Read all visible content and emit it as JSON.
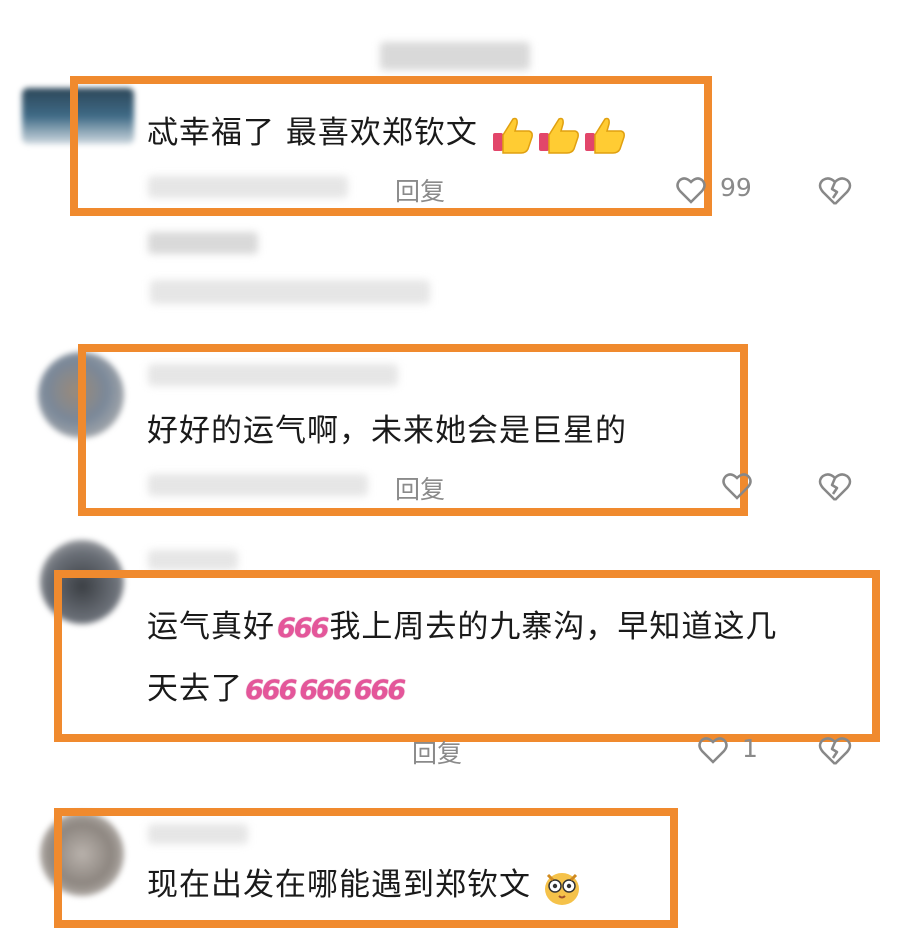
{
  "comments": [
    {
      "text": "忒幸福了 最喜欢郑钦文",
      "reply_label": "回复",
      "like_count": "99",
      "emoji": "thumbs-up x3"
    },
    {
      "text": "好好的运气啊，未来她会是巨星的",
      "reply_label": "回复"
    },
    {
      "text_line1": "运气真好",
      "text_line1b": "我上周去的九寨沟，早知道这几",
      "text_line2": "天去了",
      "six": "666",
      "reply_label": "回复",
      "like_count": "1"
    },
    {
      "text": "现在出发在哪能遇到郑钦文"
    }
  ],
  "colors": {
    "highlight": "#f08a2e",
    "secondary_text": "#8a8a8a",
    "emoji_pink": "#e4569a"
  },
  "icons": [
    "heart-outline-icon",
    "broken-heart-icon",
    "thumbs-up-emoji",
    "shocked-owl-emoji"
  ]
}
